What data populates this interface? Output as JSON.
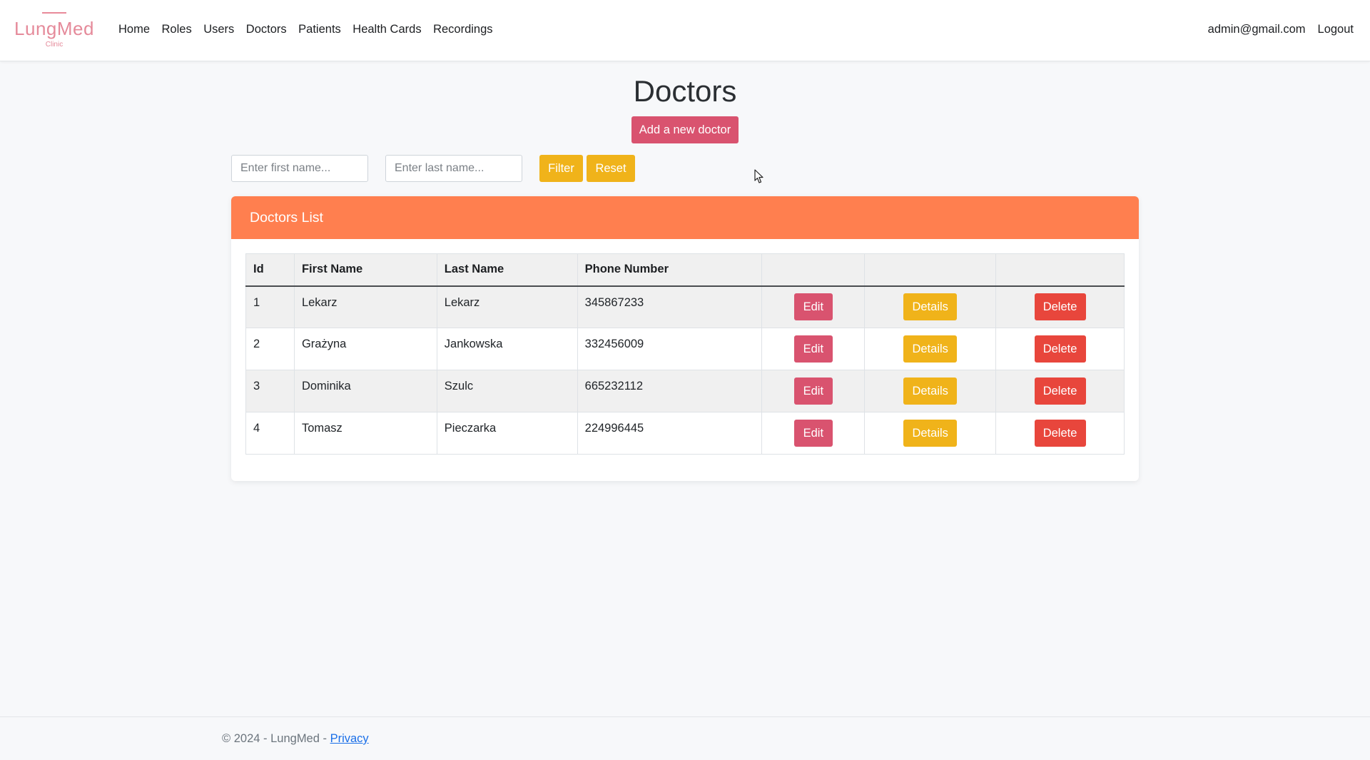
{
  "brand": {
    "name": "LungMed",
    "subtitle": "Clinic"
  },
  "nav": {
    "links": [
      "Home",
      "Roles",
      "Users",
      "Doctors",
      "Patients",
      "Health Cards",
      "Recordings"
    ],
    "user_email": "admin@gmail.com",
    "logout": "Logout"
  },
  "page": {
    "title": "Doctors",
    "add_button": "Add a new doctor"
  },
  "filter": {
    "first_name_placeholder": "Enter first name...",
    "last_name_placeholder": "Enter last name...",
    "filter_button": "Filter",
    "reset_button": "Reset"
  },
  "card": {
    "title": "Doctors List"
  },
  "table": {
    "columns": [
      "Id",
      "First Name",
      "Last Name",
      "Phone Number",
      "",
      "",
      ""
    ],
    "rows": [
      {
        "id": "1",
        "first_name": "Lekarz",
        "last_name": "Lekarz",
        "phone": "345867233"
      },
      {
        "id": "2",
        "first_name": "Grażyna",
        "last_name": "Jankowska",
        "phone": "332456009"
      },
      {
        "id": "3",
        "first_name": "Dominika",
        "last_name": "Szulc",
        "phone": "665232112"
      },
      {
        "id": "4",
        "first_name": "Tomasz",
        "last_name": "Pieczarka",
        "phone": "224996445"
      }
    ],
    "actions": {
      "edit": "Edit",
      "details": "Details",
      "delete": "Delete"
    }
  },
  "footer": {
    "text": "© 2024 - LungMed - ",
    "privacy": "Privacy"
  },
  "colors": {
    "accent_pink": "#d9536f",
    "accent_yellow": "#f0b31a",
    "danger_red": "#e8463c",
    "header_orange": "#ff7f4f",
    "brand_pink": "#e58a9a"
  }
}
